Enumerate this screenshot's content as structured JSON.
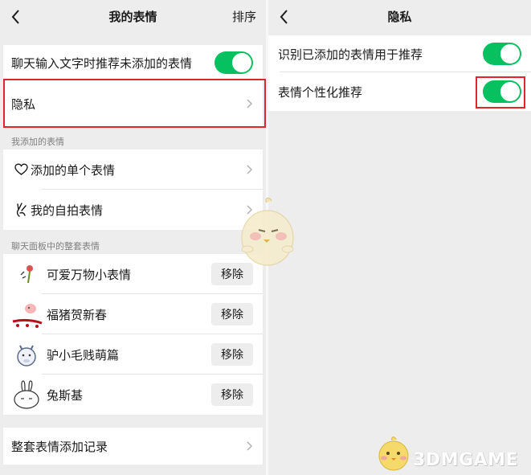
{
  "left": {
    "title": "我的表情",
    "action": "排序",
    "recommend_label": "聊天输入文字时推荐未添加的表情",
    "privacy_label": "隐私",
    "section_added": "我添加的表情",
    "single_label": "添加的单个表情",
    "selfie_label": "我的自拍表情",
    "section_packs": "聊天面板中的整套表情",
    "packs": [
      {
        "name": "可爱万物小表情",
        "button": "移除"
      },
      {
        "name": "福猪贺新春",
        "button": "移除"
      },
      {
        "name": "驴小毛贱萌篇",
        "button": "移除"
      },
      {
        "name": "兔斯基",
        "button": "移除"
      }
    ],
    "history_label": "整套表情添加记录"
  },
  "right": {
    "title": "隐私",
    "rows": [
      {
        "label": "识别已添加的表情用于推荐",
        "enabled": true
      },
      {
        "label": "表情个性化推荐",
        "enabled": true
      }
    ]
  },
  "watermark": {
    "text": "3DMGAME"
  },
  "colors": {
    "toggle_on": "#07c160",
    "highlight": "#e0262c",
    "background": "#ededed"
  }
}
